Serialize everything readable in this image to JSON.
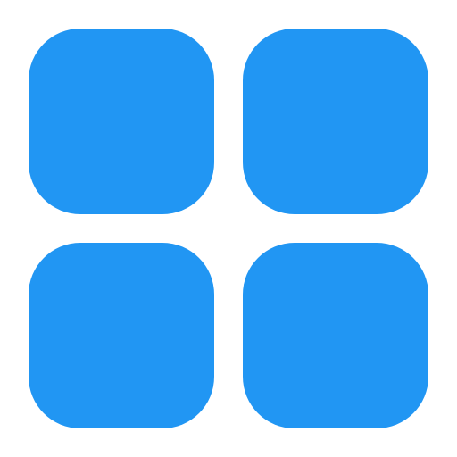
{
  "icon": {
    "name": "apps-grid-icon",
    "tile_color": "#2196F3",
    "background_color": "#FFFFFF",
    "tiles": [
      {
        "id": "top-left"
      },
      {
        "id": "top-right"
      },
      {
        "id": "bottom-left"
      },
      {
        "id": "bottom-right"
      }
    ]
  }
}
